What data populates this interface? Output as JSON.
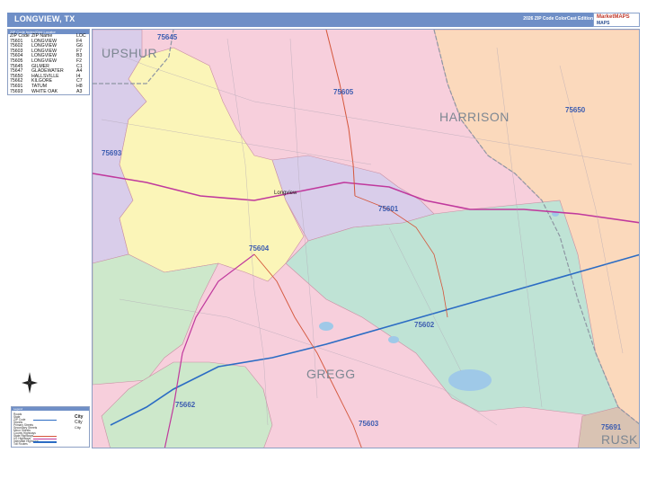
{
  "header": {
    "title": "LONGVIEW, TX",
    "edition": "2026 ZIP Code ColorCast Edition",
    "logo_line1": "MarketMAPS",
    "logo_line2": "MAPS"
  },
  "zip_index": {
    "heading": "ZIP Code Index/Grid Locator",
    "columns": [
      "ZIP Code",
      "ZIP Name",
      "LOC"
    ],
    "rows": [
      [
        "75601",
        "LONGVIEW",
        "F4"
      ],
      [
        "75602",
        "LONGVIEW",
        "G6"
      ],
      [
        "75603",
        "LONGVIEW",
        "F7"
      ],
      [
        "75604",
        "LONGVIEW",
        "B3"
      ],
      [
        "75605",
        "LONGVIEW",
        "F2"
      ],
      [
        "75645",
        "GILMER",
        "C1"
      ],
      [
        "75647",
        "GLADEWATER",
        "A4"
      ],
      [
        "75650",
        "HALLSVILLE",
        "I4"
      ],
      [
        "75662",
        "KILGORE",
        "C7"
      ],
      [
        "75691",
        "TATUM",
        "H8"
      ],
      [
        "75693",
        "WHITE OAK",
        "A3"
      ]
    ]
  },
  "map": {
    "zip_labels": [
      "75645",
      "75605",
      "75650",
      "75693",
      "75601",
      "75604",
      "75602",
      "75662",
      "75603",
      "75691"
    ],
    "county_labels": [
      "UPSHUR",
      "HARRISON",
      "GREGG",
      "RUSK"
    ],
    "city_labels": [
      "Longview"
    ],
    "colors": {
      "pink": "#f7cfdc",
      "yellow": "#fbf5b8",
      "lavender": "#d9cdea",
      "peach": "#fbd9bc",
      "teal": "#bfe3d5",
      "green": "#cde8cb",
      "lilac": "#e6c9e9",
      "tan": "#d9c3b3",
      "highway": "#c0399d",
      "boundary": "#2b6cc4"
    }
  },
  "legend": {
    "heading": "Legend",
    "rows": [
      "Roads",
      "State",
      "ZIP Code",
      "Streets",
      "Primary Streets",
      "Secondary Streets",
      "Minor Streets",
      "County Highways",
      "State Highways",
      "US Highways",
      "Interstate Highways",
      "Toll Routes"
    ],
    "samples": [
      "City",
      "City",
      "City"
    ]
  },
  "compass_icon": "compass-rose-icon"
}
